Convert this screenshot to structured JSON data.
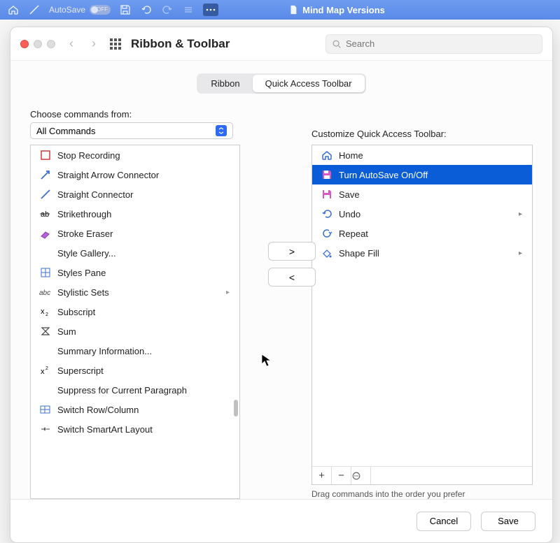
{
  "app_bar": {
    "autosave_text": "AutoSave",
    "document_title": "Mind Map Versions"
  },
  "modal": {
    "title": "Ribbon & Toolbar",
    "search_placeholder": "Search"
  },
  "tabs": {
    "ribbon": "Ribbon",
    "qat": "Quick Access Toolbar"
  },
  "left_panel": {
    "label": "Choose commands from:",
    "dropdown_value": "All Commands",
    "commands": [
      {
        "name": "Stop Recording",
        "icon": "square-red"
      },
      {
        "name": "Straight Arrow Connector",
        "icon": "arrow-blue"
      },
      {
        "name": "Straight Connector",
        "icon": "line-blue"
      },
      {
        "name": "Strikethrough",
        "icon": "strike"
      },
      {
        "name": "Stroke Eraser",
        "icon": "eraser-purple"
      },
      {
        "name": "Style Gallery...",
        "icon": ""
      },
      {
        "name": "Styles Pane",
        "icon": "grid-pane"
      },
      {
        "name": "Stylistic Sets",
        "icon": "abc",
        "submenu": true
      },
      {
        "name": "Subscript",
        "icon": "x2-low"
      },
      {
        "name": "Sum",
        "icon": "sigma"
      },
      {
        "name": "Summary Information...",
        "icon": ""
      },
      {
        "name": "Superscript",
        "icon": "x2-high"
      },
      {
        "name": "Suppress for Current Paragraph",
        "icon": ""
      },
      {
        "name": "Switch Row/Column",
        "icon": "switch-rc"
      },
      {
        "name": "Switch SmartArt Layout",
        "icon": "switch-sa"
      }
    ]
  },
  "right_panel": {
    "label": "Customize Quick Access Toolbar:",
    "items": [
      {
        "name": "Home",
        "icon": "home",
        "submenu": false
      },
      {
        "name": "Turn AutoSave On/Off",
        "icon": "save-pink",
        "selected": true
      },
      {
        "name": "Save",
        "icon": "save-pink"
      },
      {
        "name": "Undo",
        "icon": "undo",
        "submenu": true
      },
      {
        "name": "Repeat",
        "icon": "repeat"
      },
      {
        "name": "Shape Fill",
        "icon": "fill",
        "submenu": true
      }
    ],
    "hint": "Drag commands into the order you prefer"
  },
  "buttons": {
    "add": ">",
    "remove": "<",
    "cancel": "Cancel",
    "save": "Save"
  }
}
